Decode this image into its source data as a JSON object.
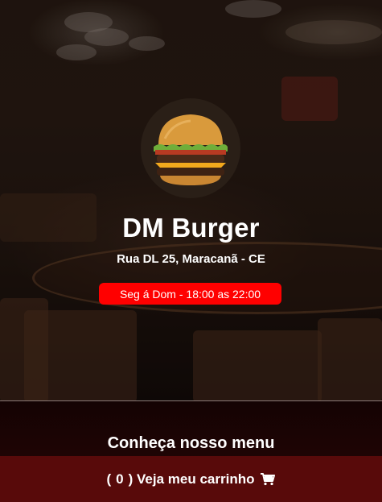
{
  "store": {
    "name": "DM Burger",
    "address": "Rua DL 25, Maracanã - CE",
    "hours": "Seg á Dom - 18:00 as 22:00",
    "logo_icon": "burger-logo"
  },
  "menu": {
    "heading": "Conheça nosso menu"
  },
  "cart": {
    "open_paren": "(",
    "count": "0",
    "close_label": ") Veja meu carrinho",
    "icon": "cart-icon"
  },
  "colors": {
    "hours_badge": "#ff0000",
    "cart_bar": "#580a0a",
    "menu_bg": "#1a0303"
  }
}
